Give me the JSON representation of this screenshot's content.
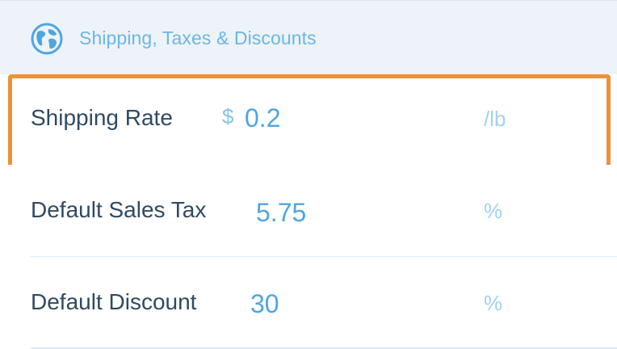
{
  "section": {
    "title": "Shipping, Taxes & Discounts",
    "icon": "globe-icon"
  },
  "rows": [
    {
      "label": "Shipping Rate",
      "currency_symbol": "$",
      "value": "0.2",
      "unit": "/lb",
      "focused": true
    },
    {
      "label": "Default Sales Tax",
      "value": "5.75",
      "unit": "%"
    },
    {
      "label": "Default Discount",
      "value": "30",
      "unit": "%"
    }
  ],
  "colors": {
    "accent": "#4fa6df",
    "header_bg": "#edf3f8",
    "label": "#2f4a63",
    "focus_border": "#ee9138"
  }
}
